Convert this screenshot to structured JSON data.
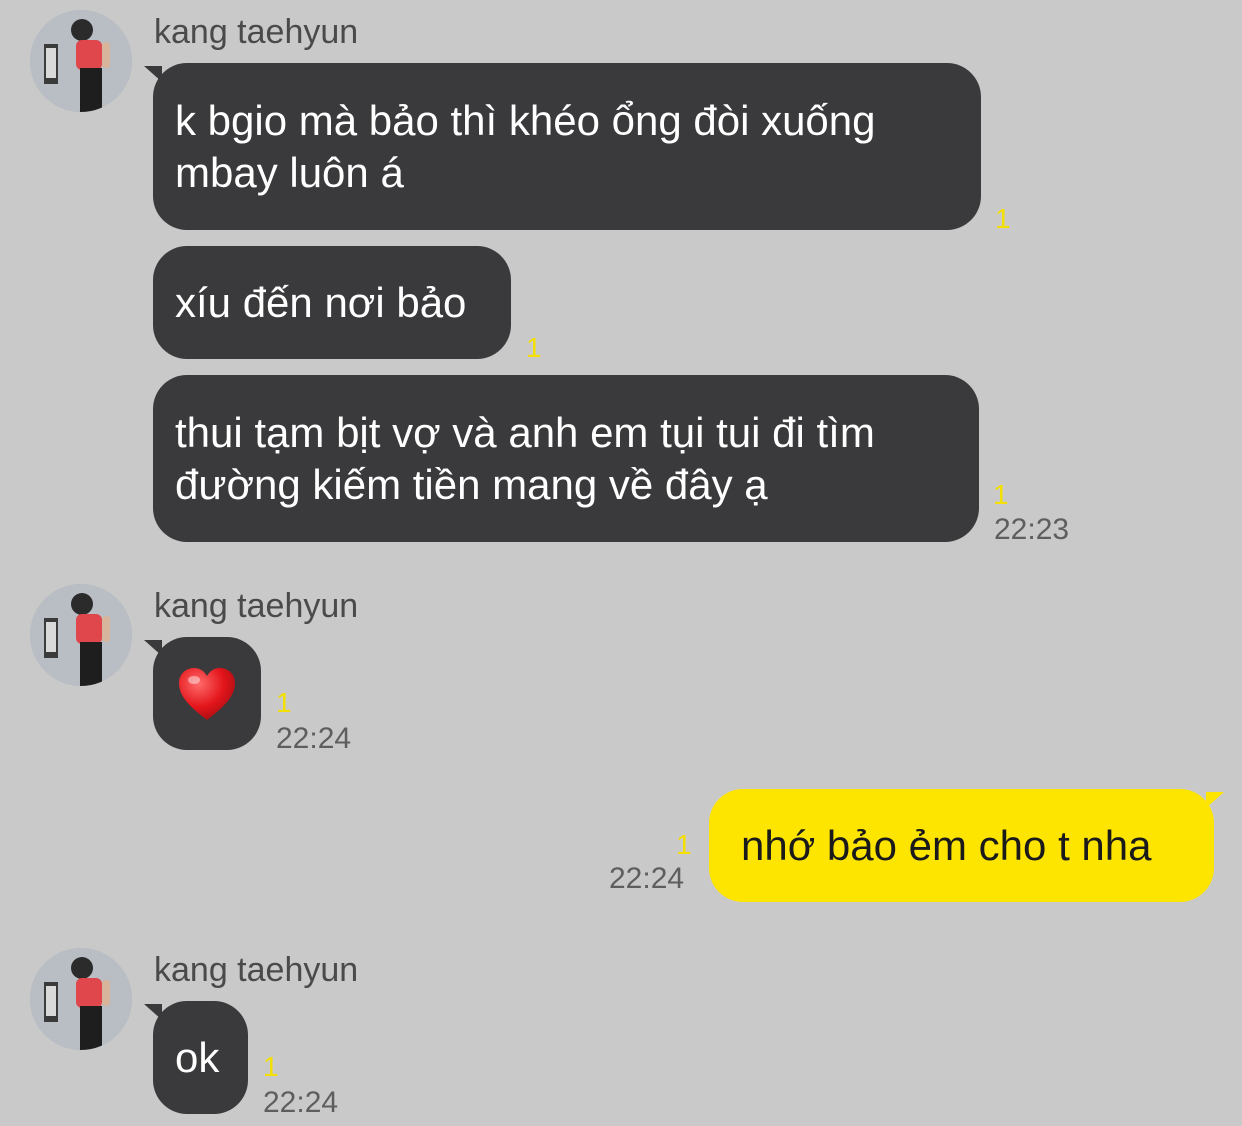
{
  "colors": {
    "background": "#c9c9c9",
    "incoming_bubble": "#3a3a3c",
    "outgoing_bubble": "#fee500",
    "unread_count": "#f4e000"
  },
  "messages": [
    {
      "sender": "kang taehyun",
      "bubbles": [
        {
          "lines": [
            "k bgio mà bảo thì khéo ổng đòi xuống",
            "mbay luôn á"
          ],
          "unread": "1",
          "time": ""
        },
        {
          "lines": [
            "xíu đến nơi bảo"
          ],
          "unread": "1",
          "time": ""
        },
        {
          "lines": [
            "thui tạm bịt vợ và anh em tụi tui đi tìm",
            "đường kiếm tiền mang về đây ạ"
          ],
          "unread": "1",
          "time": "22:23"
        }
      ]
    },
    {
      "sender": "kang taehyun",
      "bubbles": [
        {
          "emoji": "heart-icon",
          "unread": "1",
          "time": "22:24"
        }
      ]
    },
    {
      "sender": "me",
      "bubbles": [
        {
          "lines": [
            "nhớ bảo ẻm cho t nha"
          ],
          "unread": "1",
          "time": "22:24"
        }
      ]
    },
    {
      "sender": "kang taehyun",
      "bubbles": [
        {
          "lines": [
            "ok"
          ],
          "unread": "1",
          "time": "22:24"
        }
      ]
    }
  ]
}
